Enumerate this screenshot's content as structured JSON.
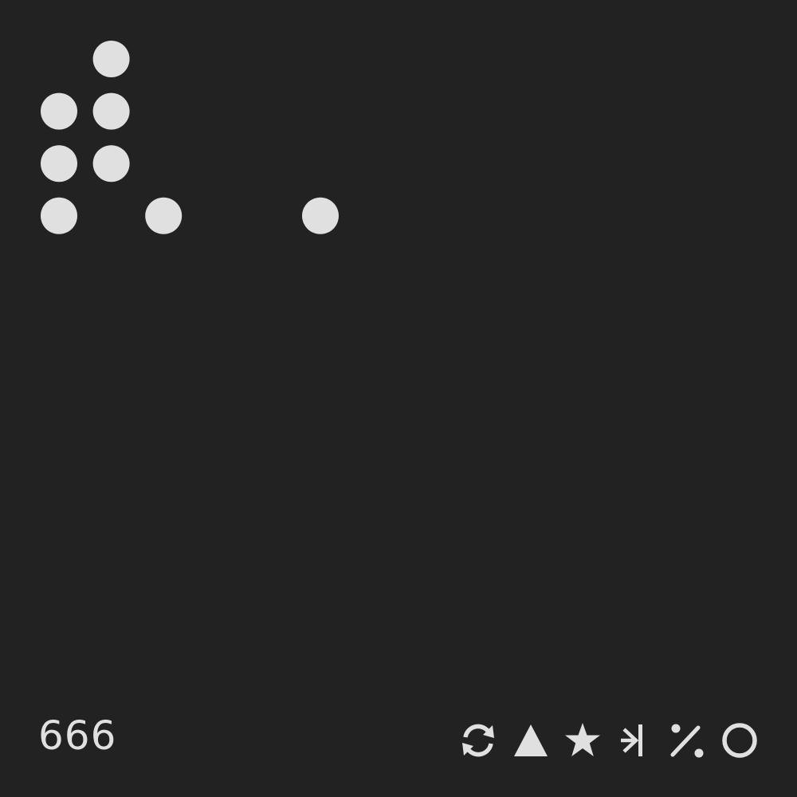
{
  "number": "666",
  "colors": {
    "background": "#222222",
    "foreground": "#e0e0e0"
  },
  "dot_pattern": {
    "columns": 6,
    "rows": 4,
    "filled": [
      [
        false,
        true,
        false,
        false,
        false,
        false
      ],
      [
        true,
        true,
        false,
        false,
        false,
        false
      ],
      [
        true,
        true,
        false,
        false,
        false,
        false
      ],
      [
        true,
        false,
        true,
        false,
        false,
        true
      ]
    ]
  },
  "icons": [
    "refresh-icon",
    "triangle-icon",
    "star-icon",
    "merge-arrows-icon",
    "percent-icon",
    "circle-icon"
  ]
}
